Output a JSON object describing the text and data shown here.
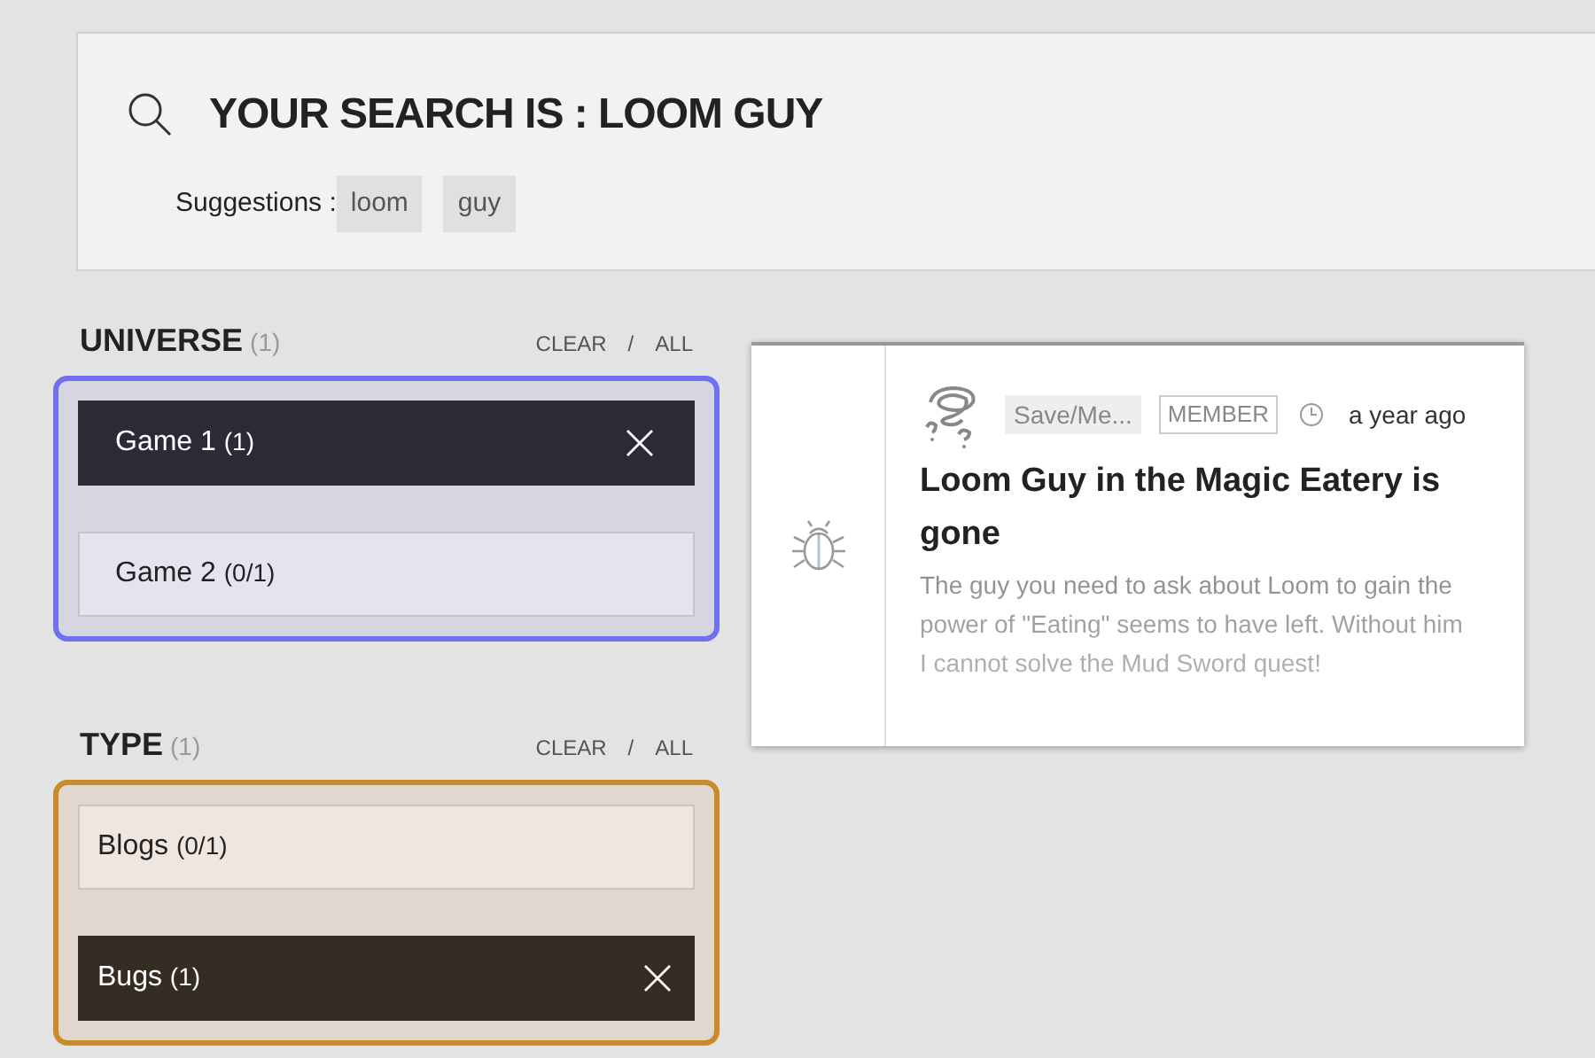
{
  "search": {
    "title": "YOUR SEARCH IS : LOOM GUY",
    "suggestions_label": "Suggestions :",
    "suggestions": [
      "loom",
      "guy"
    ]
  },
  "filters": [
    {
      "title": "UNIVERSE",
      "count": "(1)",
      "clear": "CLEAR",
      "separator": "/",
      "all": "ALL",
      "color": "#7070f0",
      "items": [
        {
          "label": "Game 1",
          "count": "(1)",
          "selected": true
        },
        {
          "label": "Game 2",
          "count": "(0/1)",
          "selected": false
        }
      ]
    },
    {
      "title": "TYPE",
      "count": "(1)",
      "clear": "CLEAR",
      "separator": "/",
      "all": "ALL",
      "color": "#c98a2c",
      "items": [
        {
          "label": "Blogs",
          "count": "(0/1)",
          "selected": false
        },
        {
          "label": "Bugs",
          "count": "(1)",
          "selected": true
        }
      ]
    }
  ],
  "result": {
    "category": "Save/Me...",
    "badge": "MEMBER",
    "time": "a year ago",
    "title": "Loom Guy in the Magic Eatery is gone",
    "description": "The guy you need to ask about Loom to gain the power of \"Eating\" seems to have left. Without him I cannot solve the Mud Sword quest!"
  }
}
